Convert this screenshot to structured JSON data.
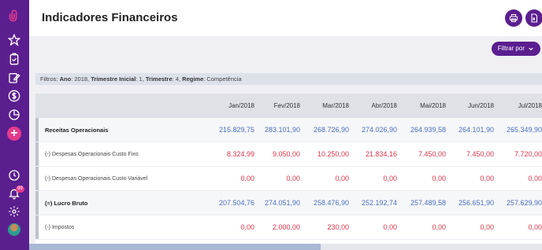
{
  "header": {
    "title": "Indicadores Financeiros",
    "print_icon": "print-icon",
    "export_icon": "excel-export-icon"
  },
  "toolbar": {
    "filter_label": "Filtrar por"
  },
  "filters": {
    "prefix": "Filtros:",
    "ano_label": "Ano",
    "ano_value": "2018",
    "trimestre_inicial_label": "Trimestre Inicial",
    "trimestre_inicial_value": "1",
    "trimestre_label": "Trimestre",
    "trimestre_value": "4",
    "regime_label": "Regime",
    "regime_value": "Competência"
  },
  "table": {
    "columns": [
      "Jan/2018",
      "Fev/2018",
      "Mar/2018",
      "Abr/2018",
      "Mai/2018",
      "Jun/2018",
      "Jul/2018"
    ],
    "rows": [
      {
        "label": "Receitas Operacionais",
        "bold": true,
        "color": "blue",
        "values": [
          "215.829,75",
          "283.101,90",
          "268.726,90",
          "274.026,90",
          "264.939,58",
          "264.101,90",
          "265.349,90"
        ]
      },
      {
        "label": "(-) Despesas Operacionais Custo Fixo",
        "bold": false,
        "color": "red",
        "values": [
          "8.324,99",
          "9.050,00",
          "10.250,00",
          "21.834,16",
          "7.450,00",
          "7.450,00",
          "7.720,00"
        ]
      },
      {
        "label": "(-) Despesas Operacionais Custo Variável",
        "bold": false,
        "color": "red",
        "values": [
          "0,00",
          "0,00",
          "0,00",
          "0,00",
          "0,00",
          "0,00",
          "0,00"
        ]
      },
      {
        "label": "(=) Lucro Bruto",
        "bold": true,
        "color": "blue",
        "values": [
          "207.504,76",
          "274.051,90",
          "258.476,90",
          "252.192,74",
          "257.489,58",
          "256.651,90",
          "257.629,90"
        ]
      },
      {
        "label": "(-) Impostos",
        "bold": false,
        "color": "red",
        "values": [
          "0,00",
          "2.000,00",
          "230,00",
          "0,00",
          "0,00",
          "0,00",
          "0,00"
        ]
      }
    ]
  },
  "sidebar": {
    "icons": [
      "paperclip-icon",
      "star-icon",
      "clipboard-check-icon",
      "edit-icon",
      "dollar-icon",
      "pie-chart-icon",
      "add-icon",
      "clock-icon",
      "bell-icon",
      "settings-icon",
      "avatar"
    ],
    "notification_count": "99"
  },
  "colors": {
    "brand": "#5b1e8f",
    "accent": "#e23b8c",
    "positive": "#4a6fbf",
    "negative": "#e0334a"
  }
}
